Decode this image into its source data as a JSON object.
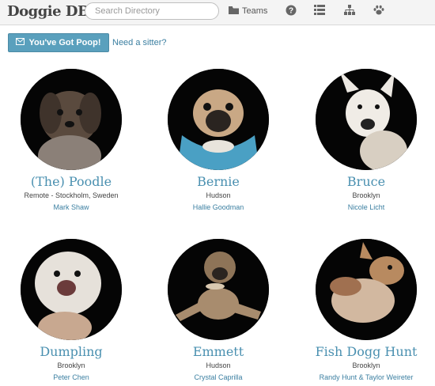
{
  "nav": {
    "brand": "Doggie DB",
    "search_placeholder": "Search Directory",
    "teams_label": "Teams",
    "icons": [
      "folder-icon",
      "help-icon",
      "list-icon",
      "org-chart-icon",
      "paw-icon"
    ]
  },
  "actions": {
    "poop_button": "You've Got Poop!",
    "sitter_link": "Need a sitter?"
  },
  "colors": {
    "accent": "#5aa0bd",
    "link": "#3b7fa1",
    "name": "#4a90b0"
  },
  "dogs": [
    {
      "name": "(The) Poodle",
      "location": "Remote - Stockholm, Sweden",
      "owner": "Mark Shaw"
    },
    {
      "name": "Bernie",
      "location": "Hudson",
      "owner": "Hallie Goodman"
    },
    {
      "name": "Bruce",
      "location": "Brooklyn",
      "owner": "Nicole Licht"
    },
    {
      "name": "Dumpling",
      "location": "Brooklyn",
      "owner": "Peter Chen"
    },
    {
      "name": "Emmett",
      "location": "Hudson",
      "owner": "Crystal Caprilla"
    },
    {
      "name": "Fish Dogg Hunt",
      "location": "Brooklyn",
      "owner": "Randy Hunt & Taylor Weireter"
    }
  ]
}
